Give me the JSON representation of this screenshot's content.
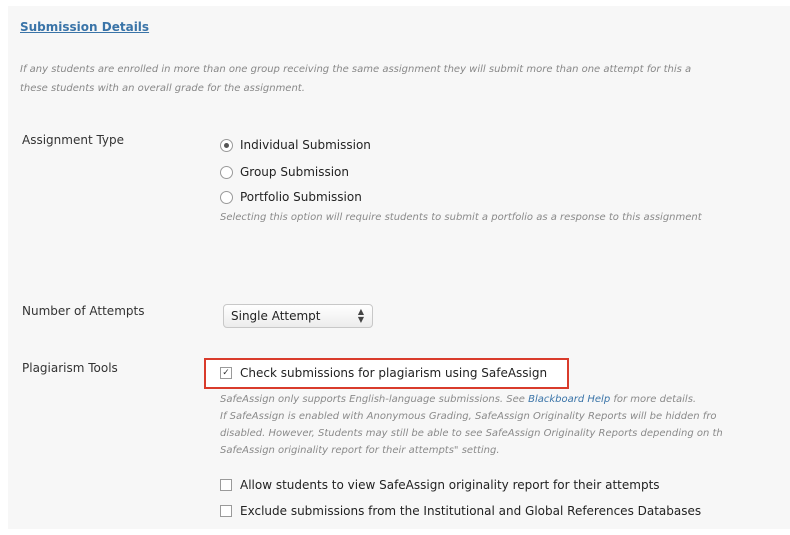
{
  "section": {
    "title": "Submission Details",
    "intro_lines": [
      "If any students are enrolled in more than one group receiving the same assignment they will submit more than one attempt for this a",
      "these students with an overall grade for the assignment."
    ]
  },
  "assignment_type": {
    "label": "Assignment Type",
    "options": [
      {
        "label": "Individual Submission",
        "checked": true
      },
      {
        "label": "Group Submission",
        "checked": false
      },
      {
        "label": "Portfolio Submission",
        "checked": false
      }
    ],
    "portfolio_hint": "Selecting this option will require students to submit a portfolio as a response to this assignment"
  },
  "attempts": {
    "label": "Number of Attempts",
    "selected": "Single Attempt"
  },
  "plagiarism": {
    "label": "Plagiarism Tools",
    "safeassign_label": "Check submissions for plagiarism using SafeAssign",
    "safeassign_checked": true,
    "note_prefix": "SafeAssign only supports English-language submissions. See ",
    "note_link": "Blackboard Help",
    "note_suffix": " for more details.",
    "note_lines": [
      "If SafeAssign is enabled with Anonymous Grading, SafeAssign Originality Reports will be hidden fro",
      "disabled. However, Students may still be able to see SafeAssign Originality Reports depending on th",
      "SafeAssign originality report for their attempts\" setting."
    ],
    "options": [
      {
        "label": "Allow students to view SafeAssign originality report for their attempts",
        "checked": false
      },
      {
        "label": "Exclude submissions from the Institutional and Global References Databases",
        "checked": false
      }
    ]
  },
  "colors": {
    "link": "#3a74a8",
    "highlight_border": "#d93b2b",
    "background": "#f7f7f7"
  }
}
